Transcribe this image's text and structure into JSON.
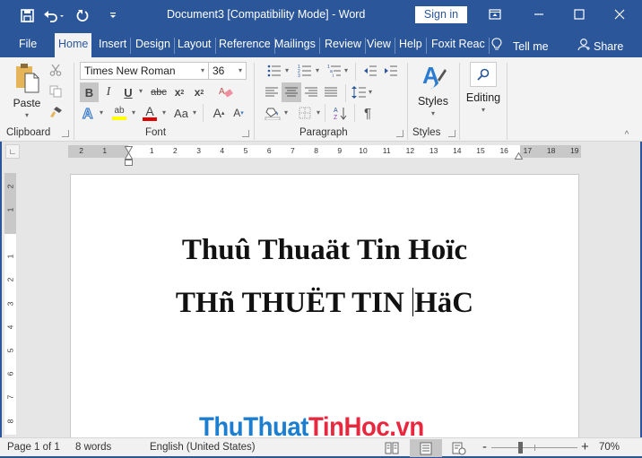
{
  "titlebar": {
    "title": "Document3 [Compatibility Mode]  -  Word",
    "sign_in": "Sign in",
    "qat": [
      {
        "icon": "save-icon"
      },
      {
        "icon": "undo-icon"
      },
      {
        "icon": "redo-icon"
      },
      {
        "icon": "customize-qat-icon"
      }
    ],
    "window_controls": [
      "ribbon-display-options-icon",
      "minimize-icon",
      "maximize-icon",
      "close-icon"
    ]
  },
  "tabs": [
    {
      "label": "File"
    },
    {
      "label": "Home",
      "active": true
    },
    {
      "label": "Insert"
    },
    {
      "label": "Design"
    },
    {
      "label": "Layout"
    },
    {
      "label": "Reference"
    },
    {
      "label": "Mailings"
    },
    {
      "label": "Review"
    },
    {
      "label": "View"
    },
    {
      "label": "Help"
    },
    {
      "label": "Foxit Reac"
    }
  ],
  "tell_me": "Tell me",
  "share": "Share",
  "ribbon": {
    "clipboard": {
      "label": "Clipboard",
      "paste": "Paste"
    },
    "font": {
      "label": "Font",
      "font_name": "Times New Roman",
      "font_size": "36",
      "bold_active": true,
      "highlight_color": "#ffff00",
      "font_color": "#e00000",
      "change_case": "Aa"
    },
    "paragraph": {
      "label": "Paragraph",
      "alignment_active": "center",
      "show_marks": "¶"
    },
    "styles": {
      "label": "Styles",
      "button": "Styles"
    },
    "editing": {
      "button": "Editing"
    }
  },
  "ruler": {
    "horizontal_numbers": [
      "2",
      "1",
      "1",
      "2",
      "3",
      "4",
      "5",
      "6",
      "7",
      "8",
      "9",
      "10",
      "11",
      "12",
      "13",
      "14",
      "15",
      "16",
      "17",
      "18",
      "19"
    ],
    "vertical_numbers": [
      "2",
      "1",
      "1",
      "2",
      "3",
      "4",
      "5",
      "6",
      "7",
      "8"
    ]
  },
  "document": {
    "line1": "Thuû Thuaät Tin Hoïc",
    "line2_before_caret": "THñ THUËT TIN ",
    "line2_after_caret": "HäC"
  },
  "watermark": {
    "part1": "ThuThuat",
    "part2": "TinHoc.vn"
  },
  "statusbar": {
    "page": "Page 1 of 1",
    "words": "8 words",
    "language": "English (United States)",
    "zoom_minus": "-",
    "zoom_plus": "+",
    "zoom_level": "70%",
    "zoom_percent": 70,
    "active_view": "print-layout"
  }
}
